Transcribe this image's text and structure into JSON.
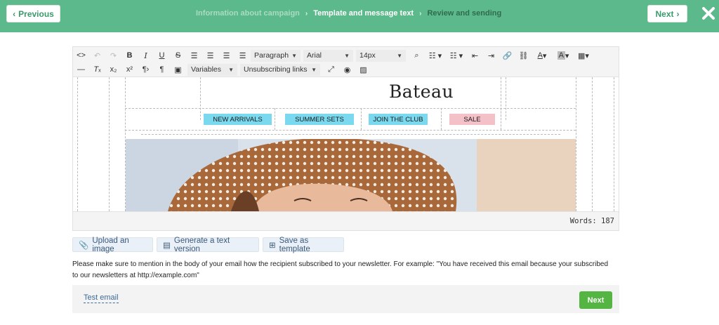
{
  "header": {
    "prev_label": "Previous",
    "next_label": "Next",
    "steps": [
      {
        "label": "Information about campaign",
        "state": "done"
      },
      {
        "label": "Template and message text",
        "state": "active"
      },
      {
        "label": "Review and sending",
        "state": "future"
      }
    ],
    "colors": {
      "bar": "#5cb98b",
      "button_text": "#3a9a6c"
    }
  },
  "toolbar": {
    "row1_icons": [
      "code-view-icon",
      "undo-icon",
      "redo-icon",
      "bold-icon",
      "italic-icon",
      "underline-icon",
      "strikethrough-icon",
      "align-left-icon",
      "align-center-icon",
      "align-right-icon",
      "align-justify-icon"
    ],
    "format_select": "Paragraph",
    "font_select": "Arial",
    "size_select": "14px",
    "row1_icons_after": [
      "binoculars-icon",
      "bullet-list-icon",
      "numbered-list-icon",
      "outdent-icon",
      "indent-icon",
      "link-icon",
      "unlink-icon",
      "font-color-icon",
      "background-color-icon",
      "table-icon"
    ],
    "row2_icons": [
      "horizontal-rule-icon",
      "clear-format-icon",
      "subscript-icon",
      "superscript-icon",
      "ltr-icon",
      "paragraph-mark-icon",
      "video-icon"
    ],
    "variables_label": "Variables",
    "unsubscribe_label": "Unsubscribing links",
    "row2_icons_after": [
      "fullscreen-icon",
      "preview-icon",
      "image-icon"
    ]
  },
  "email_preview": {
    "brand": "Bateau",
    "nav": [
      {
        "label": "NEW ARRIVALS",
        "color": "#7ad9ee"
      },
      {
        "label": "SUMMER SETS",
        "color": "#7ad9ee"
      },
      {
        "label": "JOIN THE CLUB",
        "color": "#7ad9ee"
      },
      {
        "label": "SALE",
        "color": "#f4c1c9"
      }
    ]
  },
  "word_count": "Words: 187",
  "actions": {
    "upload": "Upload an image",
    "text_version": "Generate a text version",
    "save_template": "Save as template"
  },
  "notice": "Please make sure to mention in the body of your email how the recipient subscribed to your newsletter. For example: \"You have received this email because your subscribed to our newsletters at http://example.com\"",
  "footer": {
    "test_email": "Test email",
    "next_label": "Next",
    "next_color": "#55b542"
  }
}
